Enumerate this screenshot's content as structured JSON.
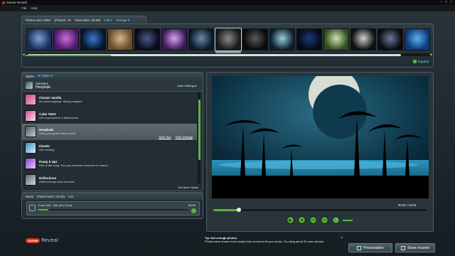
{
  "window": {
    "title": "muvee Reveal",
    "buttons": [
      "–",
      "□",
      "×"
    ]
  },
  "menu": [
    "File",
    "Help"
  ],
  "photos": {
    "tab_label": "Photos and Video",
    "photos_count": "(Photos: 70",
    "total_video": "Total video: 00:00)",
    "add": "Add ▾",
    "arrange": "Arrange ▾",
    "expand": "Expand",
    "thumbs": [
      {
        "c1": "#1a2d5a",
        "c2": "#7aa0d8"
      },
      {
        "c1": "#4a1a6a",
        "c2": "#d06ad8"
      },
      {
        "c1": "#05152c",
        "c2": "#3a7ad0"
      },
      {
        "c1": "#6a4a2a",
        "c2": "#d8b88a"
      },
      {
        "c1": "#0a0a1a",
        "c2": "#4a5a8a"
      },
      {
        "c1": "#3a1a5a",
        "c2": "#e0a0f0"
      },
      {
        "c1": "#0a1a2a",
        "c2": "#6a8aaa"
      },
      {
        "c1": "#1a1a1a",
        "c2": "#8a8a8a"
      },
      {
        "c1": "#0a0a0a",
        "c2": "#5a5a5a"
      },
      {
        "c1": "#0a2030",
        "c2": "#9ad0e0"
      },
      {
        "c1": "#050a15",
        "c2": "#1a3a7a"
      },
      {
        "c1": "#30501a",
        "c2": "#d0e0c0"
      },
      {
        "c1": "#101010",
        "c2": "#d0d0d0"
      },
      {
        "c1": "#0a0a12",
        "c2": "#6a7a9a"
      },
      {
        "c1": "#0a3a7a",
        "c2": "#5ab0f0"
      }
    ]
  },
  "styles": {
    "tab_label": "Styles",
    "all_styles": "All Styles ▾",
    "selected_label": "Selected:",
    "selected_name": "Hexplode",
    "style_settings": "Style Settings ▸",
    "get_more": "Get More Styles",
    "items": [
      {
        "name": "Classic Vanilla",
        "desc": "No extra toppings. Simply elegant.",
        "c1": "#c84a8a",
        "c2": "#f0b0d0"
      },
      {
        "name": "Cube Twist",
        "desc": "Life expressed in 6 dimensions.",
        "c1": "#d84a9a",
        "c2": "#fae0f0"
      },
      {
        "name": "Hexplode",
        "desc": "Give your sports video a kick.",
        "c1": "#4a5a60",
        "c2": "#c0cad0",
        "style_tips": "Style Tips",
        "style_settings": "Style Settings"
      },
      {
        "name": "Kinetic",
        "desc": "Get moving!",
        "c1": "#3a8ac0",
        "c2": "#e0f0ff"
      },
      {
        "name": "Pump It Up!",
        "desc": "Pick a fast song. Put your aerobics instructor to shame.",
        "c1": "#7a4ad0",
        "c2": "#f0c0ff"
      },
      {
        "name": "Reflections",
        "desc": "Glide through each moment.",
        "c1": "#5a6a70",
        "c2": "#d0d8dc"
      }
    ]
  },
  "music": {
    "tab_label": "Music",
    "total": "(Total music: 04:00)",
    "add": "Add",
    "track_name": "Front 242 - Skin (For God)",
    "track_time": "00:00",
    "track_end": "00:00"
  },
  "preview": {
    "time": "00:30 / 04:05",
    "progress": 0.12,
    "controls": [
      "▶",
      "■",
      "⏮",
      "⏭",
      "🔊"
    ]
  },
  "logo": {
    "badge": "muvee",
    "text": "Reveal"
  },
  "tip": {
    "title": "Tip: Not enough photos.",
    "body": "Photos were shown more slowly than normal to fit your music. Try using about 31 more photos.",
    "close": "×"
  },
  "buttons": {
    "personalize": "Personalize",
    "save_muvee": "Save muvee"
  }
}
